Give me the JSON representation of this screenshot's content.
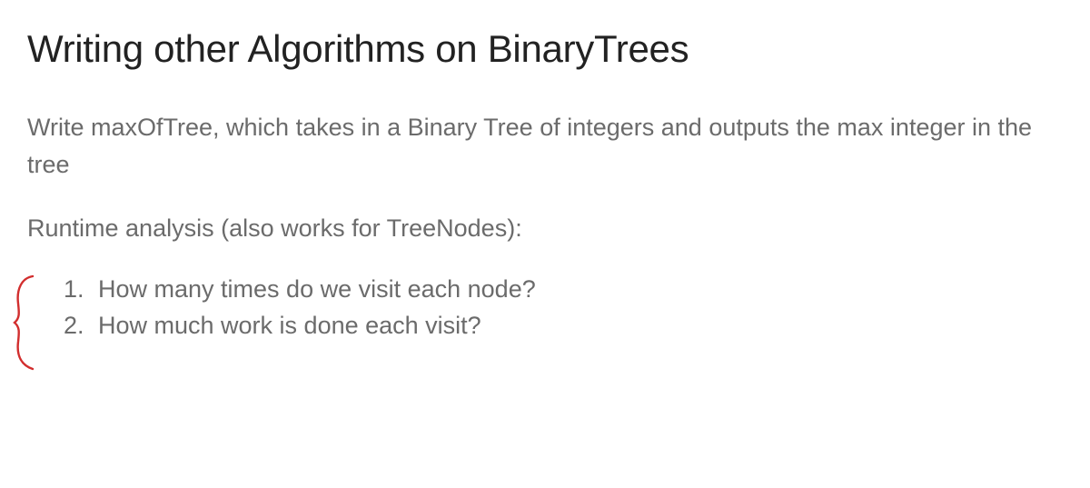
{
  "title": "Writing other Algorithms on BinaryTrees",
  "paragraph": "Write maxOfTree, which takes in a Binary Tree of integers and outputs the max integer in the tree",
  "subhead": "Runtime analysis (also works for TreeNodes):",
  "list": {
    "items": [
      "How many times do we visit each node?",
      "How much work is done each visit?"
    ]
  },
  "annotation": {
    "brace_color": "#d22e2e"
  }
}
